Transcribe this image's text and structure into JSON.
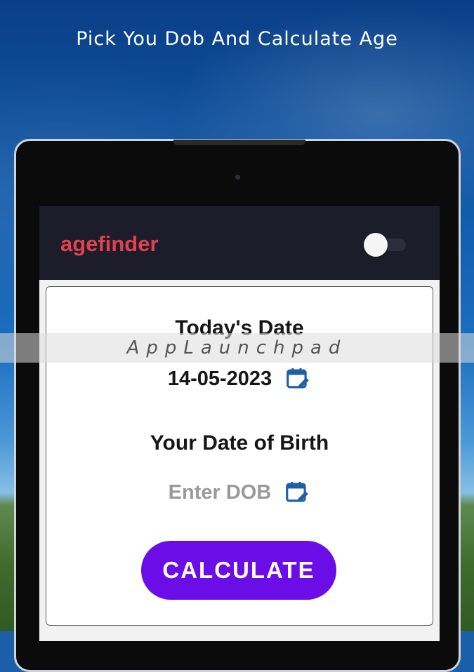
{
  "headline": "Pick You Dob And Calculate Age",
  "app": {
    "title": "agefinder",
    "title_color": "#e2414c",
    "theme_toggle": {
      "state": "off"
    }
  },
  "today": {
    "label": "Today's Date",
    "value": "14-05-2023",
    "icon": "calendar-edit-icon"
  },
  "dob": {
    "label": "Your Date of Birth",
    "placeholder": "Enter DOB",
    "icon": "calendar-edit-icon"
  },
  "calculate_button": {
    "label": "CALCULATE",
    "color": "#6a0de6"
  },
  "watermark": "AppLaunchpad"
}
